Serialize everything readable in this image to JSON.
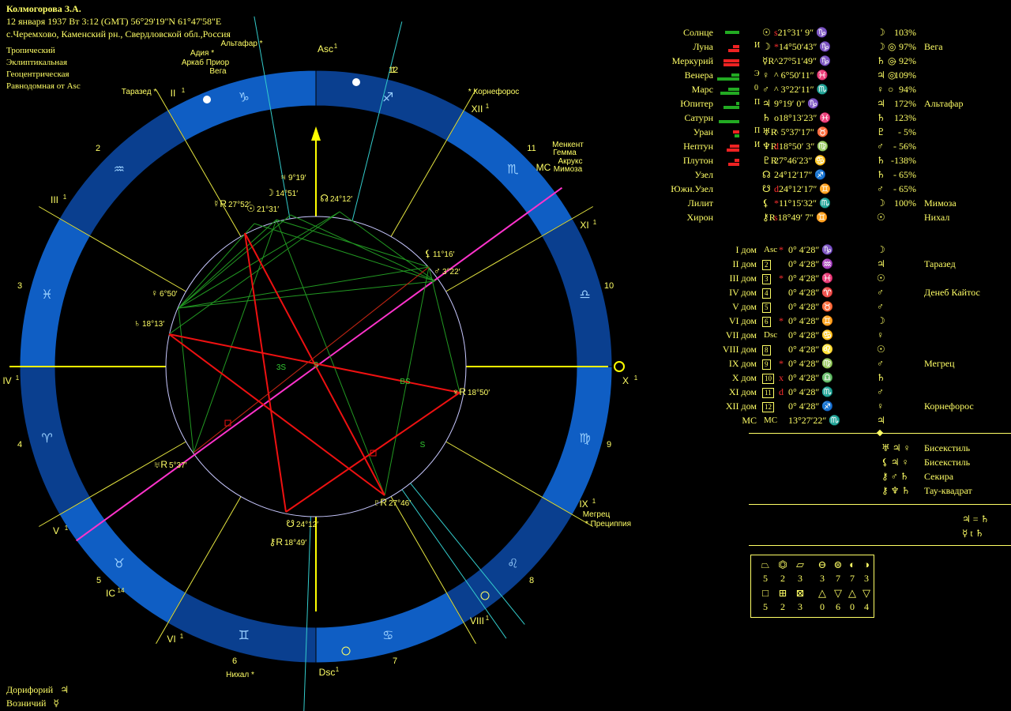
{
  "header": {
    "name": "Колмогорова З.А.",
    "line2": "12 января 1937  Вт   3:12 (GMT) 56°29'19\"N  61°47'58\"E",
    "line3": "с.Черемхово, Каменский рн., Свердловской обл.,Россия"
  },
  "meta": [
    "Тропический",
    "Эклиптикальная",
    "Геоцентрическая",
    "Равнодомная от Asc"
  ],
  "planets": [
    {
      "name": "Солнце",
      "glyph": "☉",
      "mark": "",
      "pos": "s21°31′ 9″ ♑",
      "lord": "☽",
      "ess": "",
      "pct": "103%",
      "star": "",
      "bars": [
        {
          "c": "#22aa22",
          "w": 18,
          "row": 0,
          "off": 10
        }
      ]
    },
    {
      "name": "Луна",
      "glyph": "☽",
      "mark": "И",
      "pos": "*14°50′43″ ♑",
      "lord": "☽",
      "ess": "◎",
      "pct": "97%",
      "star": "Вега",
      "bars": [
        {
          "c": "#ee2222",
          "w": 8,
          "row": 0,
          "off": 20
        },
        {
          "c": "#ee2222",
          "w": 14,
          "row": 1,
          "off": 14
        }
      ]
    },
    {
      "name": "Меркурий",
      "glyph": "☿R",
      "mark": "",
      "pos": "^27°51′49″ ♑",
      "lord": "♄",
      "ess": "◎",
      "pct": "- 92%",
      "star": "",
      "bars": [
        {
          "c": "#ee2222",
          "w": 20,
          "row": 0,
          "off": 8
        },
        {
          "c": "#ee2222",
          "w": 20,
          "row": 1,
          "off": 8
        }
      ]
    },
    {
      "name": "Венера",
      "glyph": "♀",
      "mark": "Э",
      "pos": "^ 6°50′11″ ♓",
      "lord": "♃",
      "ess": "◎",
      "pct": "109%",
      "star": "",
      "bars": [
        {
          "c": "#22aa22",
          "w": 10,
          "row": 0,
          "off": 18
        },
        {
          "c": "#22aa22",
          "w": 28,
          "row": 1,
          "off": 0
        }
      ]
    },
    {
      "name": "Марс",
      "glyph": "♂",
      "mark": "0",
      "pos": "^ 3°22′11″ ♏",
      "lord": "♀",
      "ess": "○",
      "pct": "94%",
      "star": "",
      "bars": [
        {
          "c": "#22aa22",
          "w": 14,
          "row": 0,
          "off": 14
        },
        {
          "c": "#22aa22",
          "w": 24,
          "row": 1,
          "off": 4
        }
      ]
    },
    {
      "name": "Юпитер",
      "glyph": "♃",
      "mark": "П",
      "pos": " 9°19′ 0″ ♑",
      "lord": "♃",
      "ess": "",
      "pct": "172%",
      "star": "Альтафар",
      "bars": [
        {
          "c": "#22aa22",
          "w": 4,
          "row": 0,
          "off": 24
        },
        {
          "c": "#22aa22",
          "w": 20,
          "row": 1,
          "off": 8
        }
      ]
    },
    {
      "name": "Сатурн",
      "glyph": "♄",
      "mark": "",
      "pos": "o18°13′23″ ♓",
      "lord": "♄",
      "ess": "",
      "pct": "123%",
      "star": "",
      "bars": [
        {
          "c": "#22aa22",
          "w": 26,
          "row": 1,
          "off": 2
        }
      ]
    },
    {
      "name": "Уран",
      "glyph": "♅R",
      "mark": "П",
      "pos": "^ 5°37′17″ ♉",
      "lord": "♇",
      "ess": "",
      "pct": "-  5%",
      "star": "",
      "bars": [
        {
          "c": "#ee2222",
          "w": 8,
          "row": 0,
          "off": 20
        },
        {
          "c": "#22aa22",
          "w": 6,
          "row": 1,
          "off": 22
        }
      ]
    },
    {
      "name": "Нептун",
      "glyph": "♆R",
      "mark": "И",
      "pos": "d18°50′ 3″ ♍",
      "lord": "♂",
      "ess": "",
      "pct": "- 56%",
      "star": "",
      "bars": [
        {
          "c": "#ee2222",
          "w": 12,
          "row": 0,
          "off": 16
        },
        {
          "c": "#ee2222",
          "w": 16,
          "row": 1,
          "off": 12
        }
      ]
    },
    {
      "name": "Плутон",
      "glyph": "♇R",
      "mark": "",
      "pos": " 27°46′23″ ♋",
      "lord": "♄",
      "ess": "",
      "pct": "-138%",
      "star": "",
      "bars": [
        {
          "c": "#ee2222",
          "w": 6,
          "row": 0,
          "off": 22
        },
        {
          "c": "#ee2222",
          "w": 14,
          "row": 1,
          "off": 14
        }
      ]
    },
    {
      "name": "Узел",
      "glyph": "☊",
      "mark": "",
      "pos": " 24°12′17″ ♐",
      "lord": "♄",
      "ess": "",
      "pct": "- 65%",
      "star": "",
      "bars": []
    },
    {
      "name": "Южн.Узел",
      "glyph": "☋",
      "mark": "",
      "pos": "d24°12′17″ ♊",
      "lord": "♂",
      "ess": "",
      "pct": "- 65%",
      "star": "",
      "bars": []
    },
    {
      "name": "Лилит",
      "glyph": "⚸",
      "mark": "",
      "pos": "*11°15′32″ ♏",
      "lord": "☽",
      "ess": "",
      "pct": "100%",
      "star": "Мимоза",
      "bars": []
    },
    {
      "name": "Хирон",
      "glyph": "⚷R",
      "mark": "",
      "pos": "s18°49′ 7″ ♊",
      "lord": "☉",
      "ess": "",
      "pct": "",
      "star": "Нихал",
      "bars": []
    }
  ],
  "houses": [
    {
      "name": "I дом",
      "box": "Asc",
      "mark": "*",
      "pos": "0°  4′28″ ♑",
      "lord": "☽",
      "star": ""
    },
    {
      "name": "II дом",
      "box": "2",
      "mark": "",
      "pos": "0°  4′28″ ♒",
      "lord": "♃",
      "star": "Таразед"
    },
    {
      "name": "III дом",
      "box": "3",
      "mark": "*",
      "pos": "0°  4′28″ ♓",
      "lord": "☉",
      "star": ""
    },
    {
      "name": "IV дом",
      "box": "4",
      "mark": "",
      "pos": "0°  4′28″ ♈",
      "lord": "♂",
      "star": "Денеб Кайтос"
    },
    {
      "name": "V дом",
      "box": "5",
      "mark": "",
      "pos": "0°  4′28″ ♉",
      "lord": "♂",
      "star": ""
    },
    {
      "name": "VI дом",
      "box": "6",
      "mark": "*",
      "pos": "0°  4′28″ ♊",
      "lord": "☽",
      "star": ""
    },
    {
      "name": "VII дом",
      "box": "Dsc",
      "mark": "",
      "pos": "0°  4′28″ ♋",
      "lord": "♀",
      "star": ""
    },
    {
      "name": "VIII дом",
      "box": "8",
      "mark": "",
      "pos": "0°  4′28″ ♌",
      "lord": "☉",
      "star": ""
    },
    {
      "name": "IX дом",
      "box": "9",
      "mark": "*",
      "pos": "0°  4′28″ ♍",
      "lord": "♂",
      "star": "Мегрец"
    },
    {
      "name": "X дом",
      "box": "10",
      "mark": "x",
      "pos": "0°  4′28″ ♎",
      "lord": "♄",
      "star": ""
    },
    {
      "name": "XI дом",
      "box": "11",
      "mark": "d",
      "pos": "0°  4′28″ ♏",
      "lord": "♂",
      "star": ""
    },
    {
      "name": "XII дом",
      "box": "12",
      "mark": "",
      "pos": "0°  4′28″ ♐",
      "lord": "♀",
      "star": "Корнефорос"
    },
    {
      "name": "MC",
      "box": "MC",
      "mark": "",
      "pos": "13°27′22″ ♏",
      "lord": "♃",
      "star": ""
    }
  ],
  "configs": [
    {
      "glyphs": "♅ ♃ ♀",
      "name": "Бисекстиль"
    },
    {
      "glyphs": "⚸ ♃ ♀",
      "name": "Бисекстиль"
    },
    {
      "glyphs": "⚷ ♂ ♄",
      "name": "Секира"
    },
    {
      "glyphs": "⚷ ♆ ♄",
      "name": "Тау-квадрат"
    }
  ],
  "relations": [
    "♃ = ♄",
    "☿ t ♄"
  ],
  "elements_top": {
    "icons": [
      "⏢",
      "⏣",
      "⏥",
      "⊖",
      "⊜",
      "◐",
      "◑"
    ],
    "values": [
      "5",
      "2",
      "3",
      "3",
      "7",
      "7",
      "3"
    ]
  },
  "elements_bottom": {
    "icons": [
      "□",
      "⊞",
      "⊠",
      "△",
      "▽",
      "△",
      "▽"
    ],
    "values": [
      "5",
      "2",
      "3",
      "0",
      "6",
      "0",
      "4"
    ]
  },
  "bottom": [
    {
      "label": "Дорифорий",
      "glyph": "♃"
    },
    {
      "label": "Возничий",
      "glyph": "☿"
    }
  ],
  "wheel": {
    "signs": [
      "♑",
      "♒",
      "♓",
      "♈",
      "♉",
      "♊",
      "♋",
      "♌",
      "♍",
      "♎",
      "♏",
      "♐"
    ],
    "house_numbers": [
      "1",
      "2",
      "3",
      "4",
      "5",
      "6",
      "7",
      "8",
      "9",
      "10",
      "11",
      "12"
    ],
    "cusp_labels": {
      "asc": "Asc",
      "asc_sup": "1",
      "dsc": "Dsc",
      "dsc_sup": "1",
      "x": "X",
      "x_sup": "1",
      "iv": "IV",
      "iv_sup": "1",
      "mc": "MC",
      "ic": "IC",
      "ic_sup": "14",
      "ii": "II",
      "iii": "III",
      "v": "V",
      "vi": "VI",
      "viii": "VIII",
      "ix": "IX",
      "xi": "XI",
      "xii": "XII",
      "roman_sup": "1"
    },
    "planet_labels": [
      {
        "glyph": "☉",
        "text": "21°31′"
      },
      {
        "glyph": "☽",
        "text": "14°51′"
      },
      {
        "glyph": "♃",
        "text": "9°19′"
      },
      {
        "glyph": "☿R",
        "text": "27°52′"
      },
      {
        "glyph": "☊",
        "text": "24°12′"
      },
      {
        "glyph": "♀",
        "text": "6°50′"
      },
      {
        "glyph": "♄",
        "text": "18°13′"
      },
      {
        "glyph": "⚸",
        "text": "11°16′"
      },
      {
        "glyph": "♂",
        "text": "3°22′"
      },
      {
        "glyph": "♆R",
        "text": "18°50′"
      },
      {
        "glyph": "♇R",
        "text": "27°46′"
      },
      {
        "glyph": "☋",
        "text": "24°12′"
      },
      {
        "glyph": "⚷R",
        "text": "18°49′"
      },
      {
        "glyph": "♅R",
        "text": "5°37′"
      }
    ],
    "stars": {
      "altafar": "Альтафар *",
      "adiya": "Адия *",
      "arkab": "Аркаб Приор",
      "vega": "Вега",
      "tarazed": "Таразед *",
      "kornef": "* Корнефорос",
      "menkent": "Менкент",
      "gemma": "Гемма",
      "arcturus": "Акрукс",
      "mimoza": "Мимоза",
      "megrez": "Мегрец",
      "precip": "* Прециппия",
      "nihal": "Нихал *"
    },
    "aspect_letters": [
      "S",
      "BS",
      "3S",
      "S"
    ]
  }
}
